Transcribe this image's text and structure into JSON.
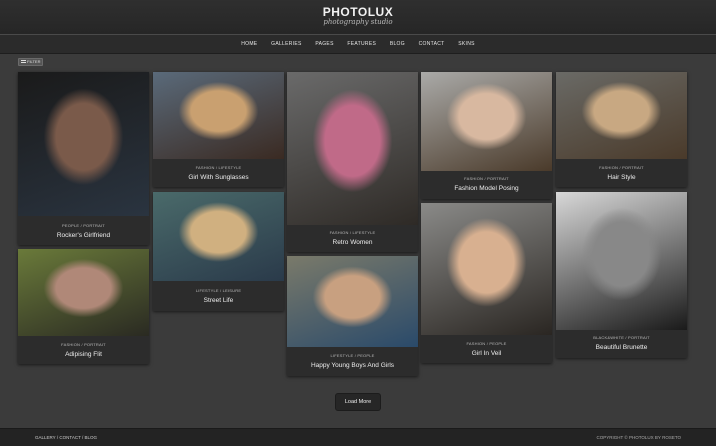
{
  "header": {
    "logo_title": "PHOTOLUX",
    "logo_subtitle": "photography studio"
  },
  "nav": {
    "items": [
      "HOME",
      "GALLERIES",
      "PAGES",
      "FEATURES",
      "BLOG",
      "CONTACT",
      "SKINS"
    ]
  },
  "filter": {
    "label": "FILTER"
  },
  "cards": [
    {
      "category": "PEOPLE / PORTRAIT",
      "title": "Rocker's Girlfriend",
      "palette": [
        "#1a1a1a",
        "#7a5a4a",
        "#2a3440"
      ]
    },
    {
      "category": "FASHION / PORTRAIT",
      "title": "Adipising Flit",
      "palette": [
        "#6a7a3a",
        "#b08878",
        "#2a2a22"
      ]
    },
    {
      "category": "FASHION / LIFESTYLE",
      "title": "Girl With Sunglasses",
      "palette": [
        "#5a6a7a",
        "#c9a070",
        "#3a2a22"
      ]
    },
    {
      "category": "LIFESTYLE / LEISURE",
      "title": "Street Life",
      "palette": [
        "#4a6a6a",
        "#d0b080",
        "#2a3a4a"
      ]
    },
    {
      "category": "FASHION / LIFESTYLE",
      "title": "Retro Women",
      "palette": [
        "#6a6a6a",
        "#c06a88",
        "#2e2a26"
      ]
    },
    {
      "category": "LIFESTYLE / PEOPLE",
      "title": "Happy Young Boys And Girls",
      "palette": [
        "#7a7a6a",
        "#c8a080",
        "#2a4a6a"
      ]
    },
    {
      "category": "FASHION / PORTRAIT",
      "title": "Fashion Model Posing",
      "palette": [
        "#aaaaa8",
        "#d8b8a0",
        "#4a3a2a"
      ]
    },
    {
      "category": "FASHION / PEOPLE",
      "title": "Girl In Veil",
      "palette": [
        "#8a8a88",
        "#d8b090",
        "#2a2622"
      ]
    },
    {
      "category": "FASHION / PORTRAIT",
      "title": "Hair Style",
      "palette": [
        "#6a6a66",
        "#c8a882",
        "#4a3a2a"
      ]
    },
    {
      "category": "BLACK&WHITE / PORTRAIT",
      "title": "Beautiful Brunette",
      "palette": [
        "#d8d8d8",
        "#888888",
        "#1a1a1a"
      ]
    }
  ],
  "load_more": {
    "label": "Load More"
  },
  "footer": {
    "links": [
      "GALLERY",
      "CONTACT",
      "BLOG"
    ],
    "separator": "/",
    "copyright": "COPYRIGHT © PHOTOLUX BY ROSETO"
  }
}
